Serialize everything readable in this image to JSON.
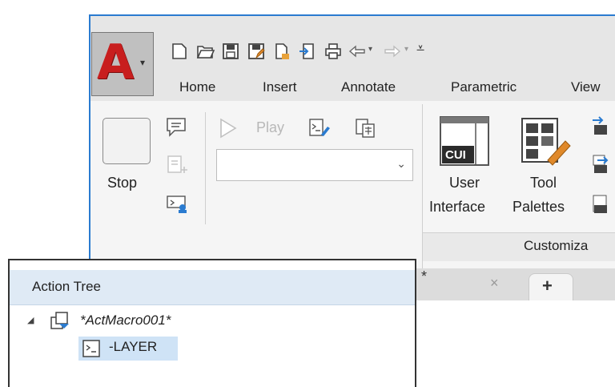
{
  "qat": {
    "icons": [
      "new-icon",
      "open-icon",
      "save-icon",
      "save-as-icon",
      "publish-icon",
      "import-icon",
      "print-icon",
      "undo-icon",
      "redo-icon",
      "customize-qat-icon"
    ]
  },
  "tabs": [
    {
      "label": "Home"
    },
    {
      "label": "Insert"
    },
    {
      "label": "Annotate"
    },
    {
      "label": "Parametric"
    },
    {
      "label": "View"
    }
  ],
  "action_recorder": {
    "stop_label": "Stop",
    "play_label": "Play",
    "macro_select_value": ""
  },
  "customization": {
    "user_interface_line1": "User",
    "user_interface_line2": "Interface",
    "cui_badge": "CUI",
    "tool_palettes_line1": "Tool",
    "tool_palettes_line2": "Palettes",
    "panel_title": "Customiza"
  },
  "file_tabs": {
    "active_suffix": "*",
    "close_symbol": "×",
    "new_tab_symbol": "+"
  },
  "action_tree": {
    "title": "Action Tree",
    "macro_name": "*ActMacro001*",
    "command": "-LAYER"
  },
  "colors": {
    "accent_blue": "#2a7bd0",
    "autocad_red": "#c81e1e",
    "header_blue": "#dfeaf5",
    "selected_row": "#cfe3f6"
  }
}
